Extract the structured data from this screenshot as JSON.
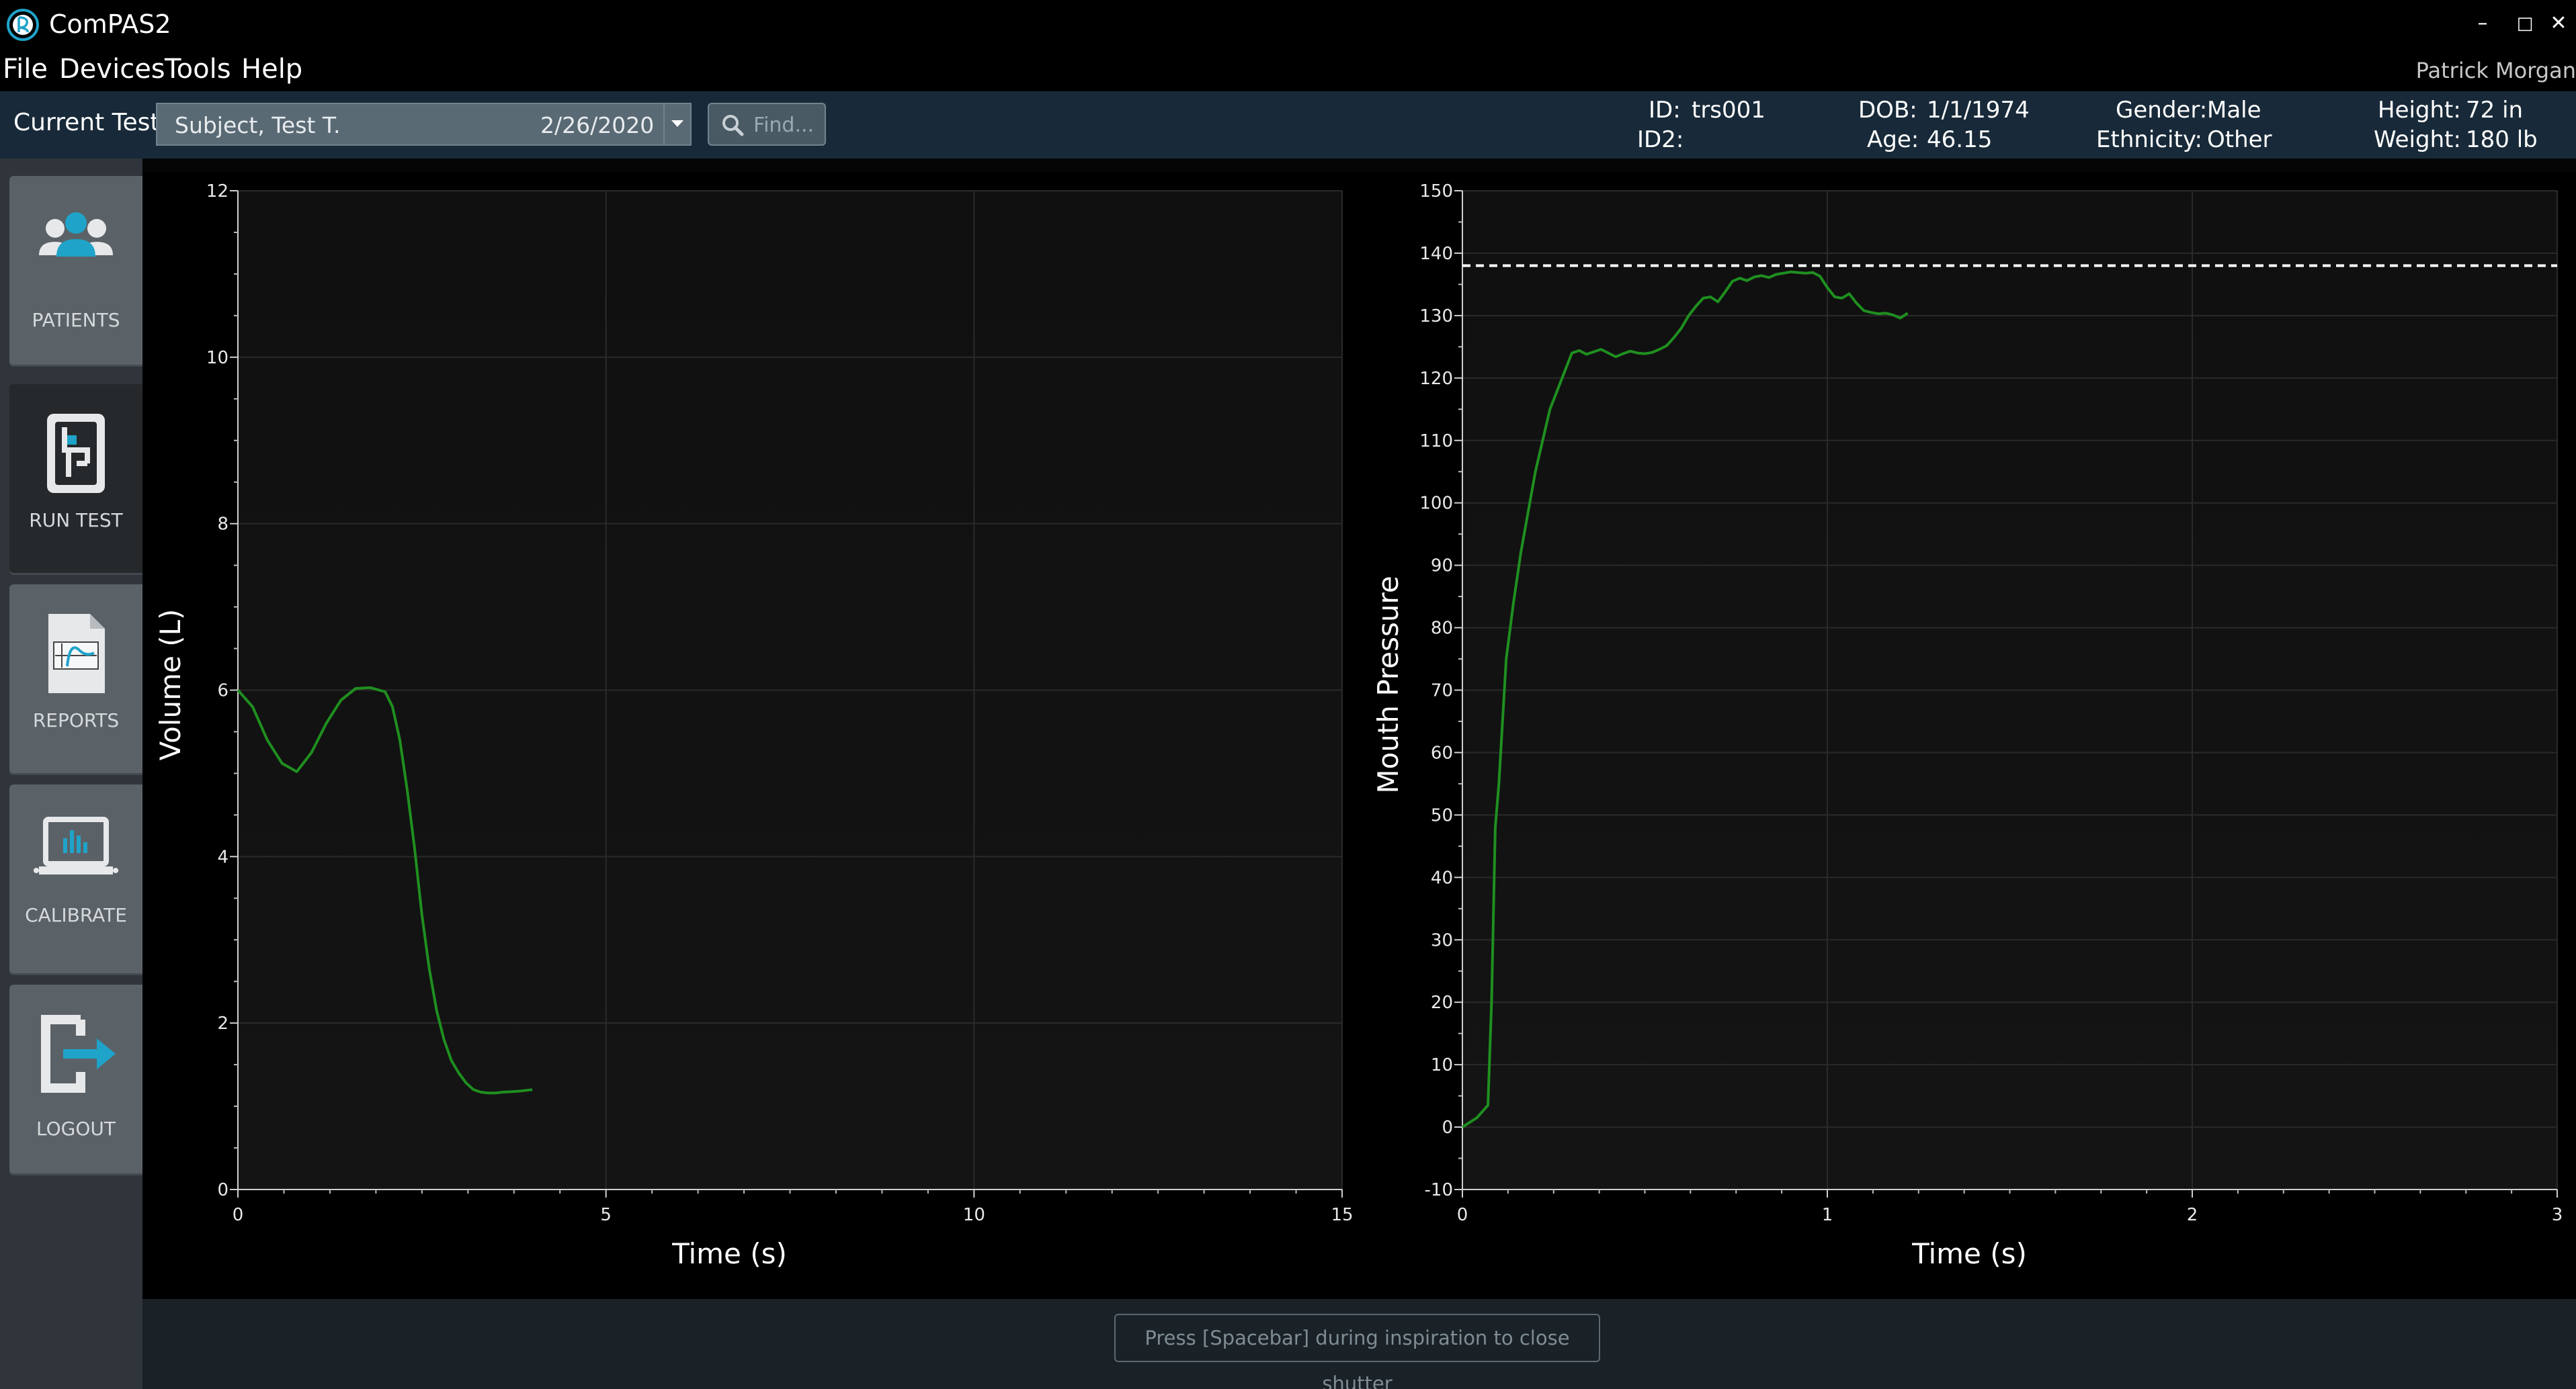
{
  "window": {
    "title": "ComPAS2",
    "minimize_glyph": "–",
    "maximize_glyph": "□",
    "close_glyph": "✕"
  },
  "menu": {
    "items": [
      "File",
      "Devices",
      "Tools",
      "Help"
    ],
    "user": "Patrick Morgan"
  },
  "test_bar": {
    "current_label": "Current Test:",
    "subject": "Subject, Test T.",
    "date": "2/26/2020",
    "find_placeholder": "Find..."
  },
  "patient": {
    "id_label": "ID:",
    "id": "trs001",
    "id2_label": "ID2:",
    "id2": "",
    "dob_label": "DOB:",
    "dob": "1/1/1974",
    "age_label": "Age:",
    "age": "46.15",
    "gender_label": "Gender:",
    "gender": "Male",
    "ethnicity_label": "Ethnicity:",
    "ethnicity": "Other",
    "height_label": "Height:",
    "height": "72 in",
    "weight_label": "Weight:",
    "weight": "180 lb"
  },
  "sidebar": {
    "items": [
      {
        "label": "PATIENTS",
        "icon": "patients-icon",
        "active": false
      },
      {
        "label": "RUN TEST",
        "icon": "run-test-icon",
        "active": true
      },
      {
        "label": "REPORTS",
        "icon": "reports-icon",
        "active": false
      },
      {
        "label": "CALIBRATE",
        "icon": "calibrate-icon",
        "active": false
      },
      {
        "label": "LOGOUT",
        "icon": "logout-icon",
        "active": false
      }
    ]
  },
  "colors": {
    "accent": "#1fa3c9",
    "trace": "#1f8f1f",
    "grid": "#2a2a2a"
  },
  "chart_data": [
    {
      "type": "line",
      "xlabel": "Time (s)",
      "ylabel": "Volume (L)",
      "xlim": [
        0,
        15
      ],
      "ylim": [
        0,
        12
      ],
      "x_ticks": [
        0,
        5,
        10,
        15
      ],
      "y_ticks": [
        0,
        2,
        4,
        6,
        8,
        10,
        12
      ],
      "grid": true,
      "series": [
        {
          "x": [
            0,
            0.2,
            0.4,
            0.6,
            0.8,
            1.0,
            1.2,
            1.4,
            1.6,
            1.8,
            2.0,
            2.1,
            2.2,
            2.3,
            2.4,
            2.5,
            2.6,
            2.7,
            2.8,
            2.9,
            3.0,
            3.1,
            3.2,
            3.3,
            3.4,
            3.5,
            3.6,
            3.8,
            4.0
          ],
          "y": [
            6.0,
            5.8,
            5.4,
            5.12,
            5.02,
            5.25,
            5.6,
            5.88,
            6.02,
            6.03,
            5.98,
            5.8,
            5.4,
            4.8,
            4.1,
            3.3,
            2.65,
            2.15,
            1.8,
            1.55,
            1.4,
            1.28,
            1.2,
            1.17,
            1.16,
            1.16,
            1.17,
            1.18,
            1.2
          ]
        }
      ]
    },
    {
      "type": "line",
      "xlabel": "Time (s)",
      "ylabel": "Mouth Pressure",
      "xlim": [
        0,
        3
      ],
      "ylim": [
        -10,
        150
      ],
      "x_ticks": [
        0,
        1,
        2,
        3
      ],
      "y_ticks": [
        -10,
        0,
        10,
        20,
        30,
        40,
        50,
        60,
        70,
        80,
        90,
        100,
        110,
        120,
        130,
        140,
        150
      ],
      "grid": true,
      "reference_line": 138,
      "series": [
        {
          "x": [
            0,
            0.04,
            0.07,
            0.08,
            0.09,
            0.1,
            0.11,
            0.12,
            0.14,
            0.16,
            0.2,
            0.24,
            0.26,
            0.28,
            0.3,
            0.32,
            0.34,
            0.36,
            0.38,
            0.4,
            0.42,
            0.44,
            0.46,
            0.48,
            0.5,
            0.52,
            0.54,
            0.56,
            0.58,
            0.6,
            0.62,
            0.64,
            0.66,
            0.68,
            0.7,
            0.72,
            0.74,
            0.76,
            0.78,
            0.8,
            0.82,
            0.84,
            0.86,
            0.88,
            0.9,
            0.92,
            0.94,
            0.96,
            0.98,
            1.0,
            1.02,
            1.04,
            1.06,
            1.08,
            1.1,
            1.12,
            1.14,
            1.16,
            1.18,
            1.2,
            1.22
          ],
          "y": [
            0,
            1.5,
            3.5,
            20,
            48,
            55,
            65,
            75,
            84,
            92,
            105,
            115,
            118,
            121,
            124,
            124.4,
            123.8,
            124.2,
            124.6,
            124,
            123.4,
            123.9,
            124.3,
            124,
            123.9,
            124.1,
            124.6,
            125.2,
            126.5,
            128,
            130,
            131.5,
            132.8,
            133,
            132.2,
            133.8,
            135.5,
            136,
            135.6,
            136.2,
            136.4,
            136.1,
            136.6,
            136.8,
            137,
            136.9,
            136.8,
            136.9,
            136.3,
            134.5,
            133,
            132.8,
            133.5,
            132,
            130.8,
            130.5,
            130.3,
            130.4,
            130.1,
            129.6,
            130.4
          ]
        }
      ]
    }
  ],
  "footer": {
    "hint": "Press [Spacebar] during inspiration to close shutter"
  }
}
